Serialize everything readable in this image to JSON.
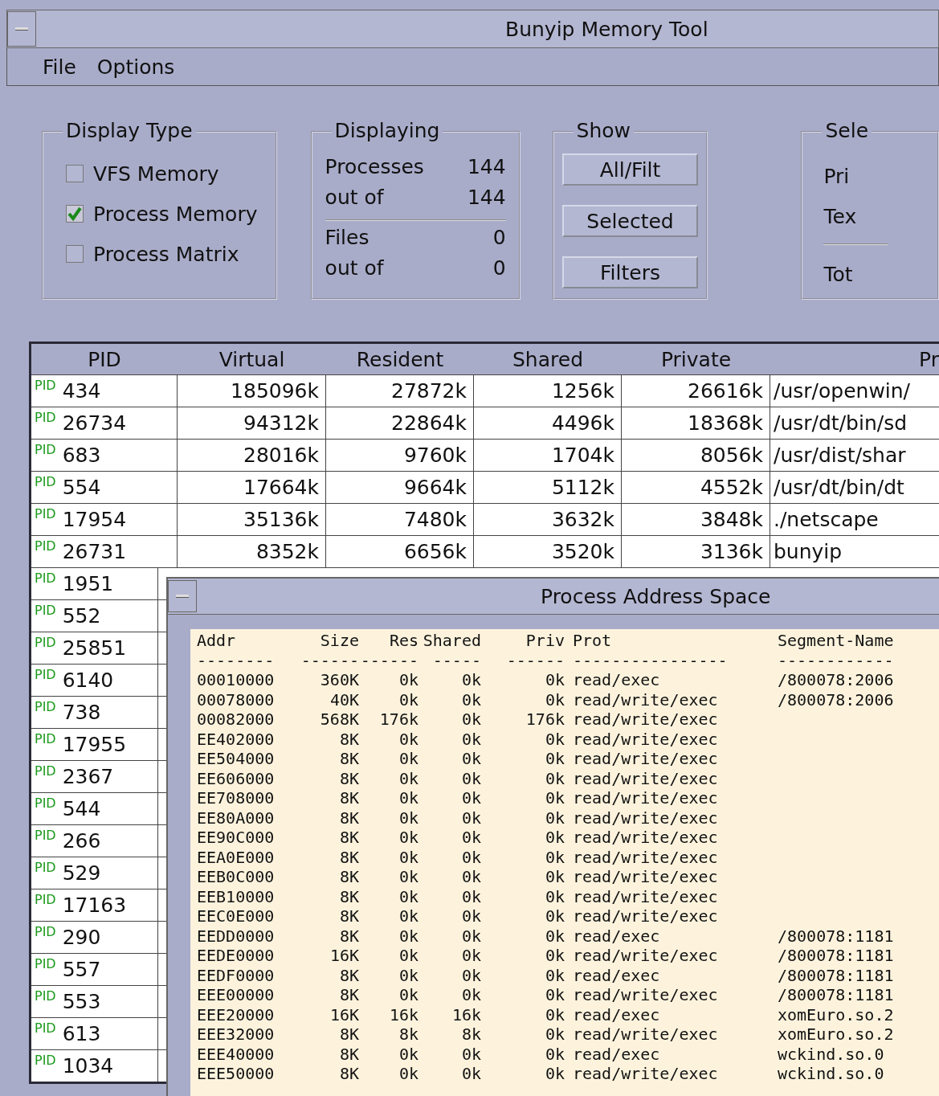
{
  "window": {
    "title": "Bunyip Memory Tool"
  },
  "menu": [
    "File",
    "Options"
  ],
  "display_type": {
    "title": "Display Type",
    "options": [
      {
        "label": "VFS Memory",
        "checked": false
      },
      {
        "label": "Process Memory",
        "checked": true
      },
      {
        "label": "Process Matrix",
        "checked": false
      }
    ]
  },
  "displaying": {
    "title": "Displaying",
    "rows": [
      {
        "label": "Processes",
        "value": "144"
      },
      {
        "label": "out of",
        "value": "144"
      },
      {
        "label": "Files",
        "value": "0"
      },
      {
        "label": "out of",
        "value": "0"
      }
    ]
  },
  "show": {
    "title": "Show",
    "buttons": [
      "All/Filt",
      "Selected",
      "Filters"
    ]
  },
  "select": {
    "title": "Sele",
    "labels": [
      "Pri",
      "Tex",
      "Tot"
    ]
  },
  "table": {
    "columns": [
      "PID",
      "Virtual",
      "Resident",
      "Shared",
      "Private",
      "Pr"
    ],
    "rows": [
      {
        "cells": [
          "$^{PID}$ 434",
          "185096k",
          "27872k",
          "1256k",
          "26616k",
          "/usr/openwin/"
        ]
      },
      {
        "cells": [
          "$^{PID}$ 26734",
          "94312k",
          "22864k",
          "4496k",
          "18368k",
          "/usr/dt/bin/sd"
        ]
      },
      {
        "cells": [
          "$^{PID}$ 683",
          "28016k",
          "9760k",
          "1704k",
          "8056k",
          "/usr/dist/shar"
        ]
      },
      {
        "cells": [
          "$^{PID}$ 554",
          "17664k",
          "9664k",
          "5112k",
          "4552k",
          "/usr/dt/bin/dt"
        ]
      },
      {
        "cells": [
          "$^{PID}$ 17954",
          "35136k",
          "7480k",
          "3632k",
          "3848k",
          "./netscape"
        ]
      },
      {
        "cells": [
          "$^{PID}$ 26731",
          "8352k",
          "6656k",
          "3520k",
          "3136k",
          "bunyip"
        ]
      },
      {
        "cells": [
          "$^{PID}$ 1951"
        ]
      },
      {
        "cells": [
          "$^{PID}$ 552"
        ]
      },
      {
        "cells": [
          "$^{PID}$ 25851"
        ]
      },
      {
        "cells": [
          "$^{PID}$ 6140"
        ]
      },
      {
        "cells": [
          "$^{PID}$ 738"
        ]
      },
      {
        "cells": [
          "$^{PID}$ 17955"
        ]
      },
      {
        "cells": [
          "$^{PID}$ 2367"
        ]
      },
      {
        "cells": [
          "$^{PID}$ 544"
        ]
      },
      {
        "cells": [
          "$^{PID}$ 266"
        ]
      },
      {
        "cells": [
          "$^{PID}$ 529"
        ]
      },
      {
        "cells": [
          "$^{PID}$ 17163"
        ]
      },
      {
        "cells": [
          "$^{PID}$ 290"
        ]
      },
      {
        "cells": [
          "$^{PID}$ 557"
        ]
      },
      {
        "cells": [
          "$^{PID}$ 553"
        ]
      },
      {
        "cells": [
          "$^{PID}$ 613"
        ]
      },
      {
        "cells": [
          "$^{PID}$ 1034"
        ]
      }
    ]
  },
  "address_space": {
    "title": "Process Address Space",
    "columns": [
      "Addr",
      "Size",
      "Res",
      "Shared",
      "Priv",
      "Prot",
      "Segment-Name"
    ],
    "dashes": [
      "--------",
      "------",
      "------",
      "-----",
      "------",
      "----------------",
      "------------"
    ],
    "rows": [
      [
        "00010000",
        "360K",
        "0k",
        "0k",
        "0k",
        "read/exec",
        "/800078:2006"
      ],
      [
        "00078000",
        "40K",
        "0k",
        "0k",
        "0k",
        "read/write/exec",
        "/800078:2006"
      ],
      [
        "00082000",
        "568K",
        "176k",
        "0k",
        "176k",
        "read/write/exec",
        ""
      ],
      [
        "EE402000",
        "8K",
        "0k",
        "0k",
        "0k",
        "read/write/exec",
        ""
      ],
      [
        "EE504000",
        "8K",
        "0k",
        "0k",
        "0k",
        "read/write/exec",
        ""
      ],
      [
        "EE606000",
        "8K",
        "0k",
        "0k",
        "0k",
        "read/write/exec",
        ""
      ],
      [
        "EE708000",
        "8K",
        "0k",
        "0k",
        "0k",
        "read/write/exec",
        ""
      ],
      [
        "EE80A000",
        "8K",
        "0k",
        "0k",
        "0k",
        "read/write/exec",
        ""
      ],
      [
        "EE90C000",
        "8K",
        "0k",
        "0k",
        "0k",
        "read/write/exec",
        ""
      ],
      [
        "EEA0E000",
        "8K",
        "0k",
        "0k",
        "0k",
        "read/write/exec",
        ""
      ],
      [
        "EEB0C000",
        "8K",
        "0k",
        "0k",
        "0k",
        "read/write/exec",
        ""
      ],
      [
        "EEB10000",
        "8K",
        "0k",
        "0k",
        "0k",
        "read/write/exec",
        ""
      ],
      [
        "EEC0E000",
        "8K",
        "0k",
        "0k",
        "0k",
        "read/write/exec",
        ""
      ],
      [
        "EEDD0000",
        "8K",
        "0k",
        "0k",
        "0k",
        "read/exec",
        "/800078:1181"
      ],
      [
        "EEDE0000",
        "16K",
        "0k",
        "0k",
        "0k",
        "read/write/exec",
        "/800078:1181"
      ],
      [
        "EEDF0000",
        "8K",
        "0k",
        "0k",
        "0k",
        "read/exec",
        "/800078:1181"
      ],
      [
        "EEE00000",
        "8K",
        "0k",
        "0k",
        "0k",
        "read/write/exec",
        "/800078:1181"
      ],
      [
        "EEE20000",
        "16K",
        "16k",
        "16k",
        "0k",
        "read/exec",
        "xomEuro.so.2"
      ],
      [
        "EEE32000",
        "8K",
        "8k",
        "8k",
        "0k",
        "read/write/exec",
        "xomEuro.so.2"
      ],
      [
        "EEE40000",
        "8K",
        "0k",
        "0k",
        "0k",
        "read/exec",
        "wckind.so.0"
      ],
      [
        "EEE50000",
        "8K",
        "0k",
        "0k",
        "0k",
        "read/write/exec",
        "wckind.so.0"
      ]
    ]
  }
}
